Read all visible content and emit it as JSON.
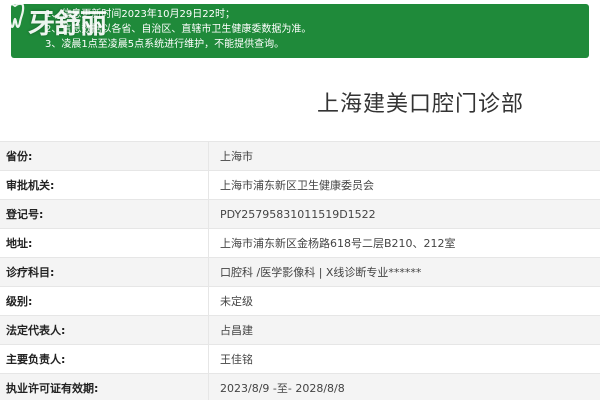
{
  "notice": {
    "lines": [
      "1、信息更新时间2023年10月29日22时；",
      "2、信息数据以各省、自治区、直辖市卫生健康委数据为准。",
      "3、凌晨1点至凌晨5点系统进行维护，不能提供查询。"
    ],
    "background_color": "#1f8a3a"
  },
  "watermark": {
    "text": "牙舒丽",
    "icon": "tooth-icon"
  },
  "page_title": "上海建美口腔门诊部",
  "rows": [
    {
      "label": "省份:",
      "value": "上海市"
    },
    {
      "label": "审批机关:",
      "value": "上海市浦东新区卫生健康委员会"
    },
    {
      "label": "登记号:",
      "value": "PDY25795831011519D1522"
    },
    {
      "label": "地址:",
      "value": "上海市浦东新区金杨路618号二层B210、212室"
    },
    {
      "label": "诊疗科目:",
      "value": "口腔科 /医学影像科 | X线诊断专业******"
    },
    {
      "label": "级别:",
      "value": "未定级"
    },
    {
      "label": "法定代表人:",
      "value": "占昌建"
    },
    {
      "label": "主要负责人:",
      "value": "王佳铭"
    },
    {
      "label": "执业许可证有效期:",
      "value": "2023/8/9 -至- 2028/8/8"
    }
  ]
}
